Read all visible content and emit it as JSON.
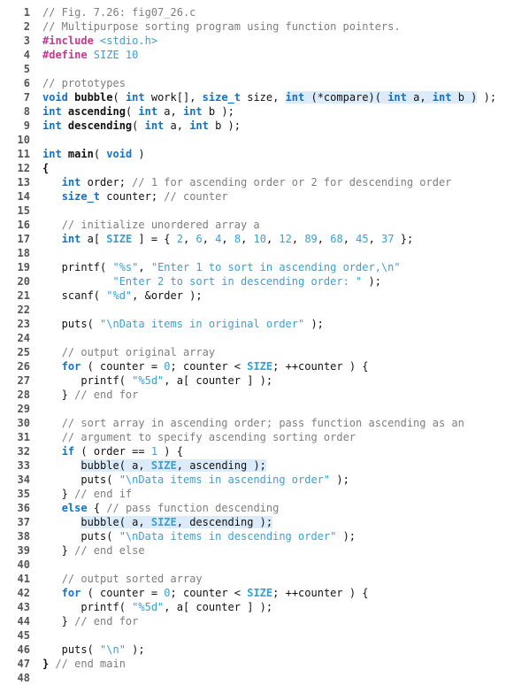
{
  "language": "c",
  "figure": "Fig. 7.26: fig07_26.c",
  "title_comment": "Multipurpose sorting program using function pointers.",
  "macros": {
    "SIZE": "10"
  },
  "array_init": [
    "2",
    "6",
    "4",
    "8",
    "10",
    "12",
    "89",
    "68",
    "45",
    "37"
  ],
  "lines": [
    {
      "n": "1",
      "segs": [
        {
          "t": "// Fig. 7.26: fig07_26.c",
          "cls": "c"
        }
      ]
    },
    {
      "n": "2",
      "segs": [
        {
          "t": "// Multipurpose sorting program using function pointers.",
          "cls": "c"
        }
      ]
    },
    {
      "n": "3",
      "segs": [
        {
          "t": "#include ",
          "cls": "pp"
        },
        {
          "t": "<stdio.h>",
          "cls": "s"
        }
      ]
    },
    {
      "n": "4",
      "segs": [
        {
          "t": "#define ",
          "cls": "pp"
        },
        {
          "t": "SIZE 10",
          "cls": "s"
        }
      ]
    },
    {
      "n": "5",
      "segs": [
        {
          "t": "",
          "cls": "id"
        }
      ]
    },
    {
      "n": "6",
      "segs": [
        {
          "t": "// prototypes",
          "cls": "c"
        }
      ]
    },
    {
      "n": "7",
      "segs": [
        {
          "t": "void ",
          "cls": "kw"
        },
        {
          "t": "bubble",
          "cls": "fn"
        },
        {
          "t": "( ",
          "cls": "op"
        },
        {
          "t": "int ",
          "cls": "ty"
        },
        {
          "t": "work[], ",
          "cls": "id"
        },
        {
          "t": "size_t ",
          "cls": "ty"
        },
        {
          "t": "size, ",
          "cls": "id"
        },
        {
          "t": "int ",
          "cls": "ty",
          "hi": true
        },
        {
          "t": "(*compare)( ",
          "cls": "id",
          "hi": true
        },
        {
          "t": "int ",
          "cls": "ty",
          "hi": true
        },
        {
          "t": "a, ",
          "cls": "id",
          "hi": true
        },
        {
          "t": "int ",
          "cls": "ty",
          "hi": true
        },
        {
          "t": "b )",
          "cls": "id",
          "hi": true
        },
        {
          "t": " );",
          "cls": "op"
        }
      ]
    },
    {
      "n": "8",
      "segs": [
        {
          "t": "int ",
          "cls": "ty"
        },
        {
          "t": "ascending",
          "cls": "fn"
        },
        {
          "t": "( ",
          "cls": "op"
        },
        {
          "t": "int ",
          "cls": "ty"
        },
        {
          "t": "a, ",
          "cls": "id"
        },
        {
          "t": "int ",
          "cls": "ty"
        },
        {
          "t": "b );",
          "cls": "id"
        }
      ]
    },
    {
      "n": "9",
      "segs": [
        {
          "t": "int ",
          "cls": "ty"
        },
        {
          "t": "descending",
          "cls": "fn"
        },
        {
          "t": "( ",
          "cls": "op"
        },
        {
          "t": "int ",
          "cls": "ty"
        },
        {
          "t": "a, ",
          "cls": "id"
        },
        {
          "t": "int ",
          "cls": "ty"
        },
        {
          "t": "b );",
          "cls": "id"
        }
      ]
    },
    {
      "n": "10",
      "segs": [
        {
          "t": "",
          "cls": "id"
        }
      ]
    },
    {
      "n": "11",
      "segs": [
        {
          "t": "int ",
          "cls": "ty"
        },
        {
          "t": "main",
          "cls": "fn"
        },
        {
          "t": "( ",
          "cls": "op"
        },
        {
          "t": "void",
          "cls": "kw"
        },
        {
          "t": " )",
          "cls": "op"
        }
      ]
    },
    {
      "n": "12",
      "segs": [
        {
          "t": "{",
          "cls": "br"
        }
      ]
    },
    {
      "n": "13",
      "segs": [
        {
          "t": "   ",
          "cls": "id"
        },
        {
          "t": "int ",
          "cls": "ty"
        },
        {
          "t": "order; ",
          "cls": "id"
        },
        {
          "t": "// 1 for ascending order or 2 for descending order",
          "cls": "c"
        }
      ]
    },
    {
      "n": "14",
      "segs": [
        {
          "t": "   ",
          "cls": "id"
        },
        {
          "t": "size_t ",
          "cls": "ty"
        },
        {
          "t": "counter; ",
          "cls": "id"
        },
        {
          "t": "// counter",
          "cls": "c"
        }
      ]
    },
    {
      "n": "15",
      "segs": [
        {
          "t": "",
          "cls": "id"
        }
      ]
    },
    {
      "n": "16",
      "segs": [
        {
          "t": "   ",
          "cls": "id"
        },
        {
          "t": "// initialize unordered array a",
          "cls": "c"
        }
      ]
    },
    {
      "n": "17",
      "segs": [
        {
          "t": "   ",
          "cls": "id"
        },
        {
          "t": "int ",
          "cls": "ty"
        },
        {
          "t": "a[ ",
          "cls": "id"
        },
        {
          "t": "SIZE",
          "cls": "m"
        },
        {
          "t": " ] = { ",
          "cls": "id"
        },
        {
          "t": "2",
          "cls": "n"
        },
        {
          "t": ", ",
          "cls": "id"
        },
        {
          "t": "6",
          "cls": "n"
        },
        {
          "t": ", ",
          "cls": "id"
        },
        {
          "t": "4",
          "cls": "n"
        },
        {
          "t": ", ",
          "cls": "id"
        },
        {
          "t": "8",
          "cls": "n"
        },
        {
          "t": ", ",
          "cls": "id"
        },
        {
          "t": "10",
          "cls": "n"
        },
        {
          "t": ", ",
          "cls": "id"
        },
        {
          "t": "12",
          "cls": "n"
        },
        {
          "t": ", ",
          "cls": "id"
        },
        {
          "t": "89",
          "cls": "n"
        },
        {
          "t": ", ",
          "cls": "id"
        },
        {
          "t": "68",
          "cls": "n"
        },
        {
          "t": ", ",
          "cls": "id"
        },
        {
          "t": "45",
          "cls": "n"
        },
        {
          "t": ", ",
          "cls": "id"
        },
        {
          "t": "37",
          "cls": "n"
        },
        {
          "t": " };",
          "cls": "id"
        }
      ]
    },
    {
      "n": "18",
      "segs": [
        {
          "t": "",
          "cls": "id"
        }
      ]
    },
    {
      "n": "19",
      "segs": [
        {
          "t": "   printf( ",
          "cls": "id"
        },
        {
          "t": "\"%s\"",
          "cls": "s"
        },
        {
          "t": ", ",
          "cls": "id"
        },
        {
          "t": "\"Enter 1 to sort in ascending order,\\n\"",
          "cls": "s"
        }
      ]
    },
    {
      "n": "20",
      "segs": [
        {
          "t": "           ",
          "cls": "id"
        },
        {
          "t": "\"Enter 2 to sort in descending order: \"",
          "cls": "s"
        },
        {
          "t": " );",
          "cls": "id"
        }
      ]
    },
    {
      "n": "21",
      "segs": [
        {
          "t": "   scanf( ",
          "cls": "id"
        },
        {
          "t": "\"%d\"",
          "cls": "s"
        },
        {
          "t": ", &order );",
          "cls": "id"
        }
      ]
    },
    {
      "n": "22",
      "segs": [
        {
          "t": "",
          "cls": "id"
        }
      ]
    },
    {
      "n": "23",
      "segs": [
        {
          "t": "   puts( ",
          "cls": "id"
        },
        {
          "t": "\"\\nData items in original order\"",
          "cls": "s"
        },
        {
          "t": " );",
          "cls": "id"
        }
      ]
    },
    {
      "n": "24",
      "segs": [
        {
          "t": "",
          "cls": "id"
        }
      ]
    },
    {
      "n": "25",
      "segs": [
        {
          "t": "   ",
          "cls": "id"
        },
        {
          "t": "// output original array",
          "cls": "c"
        }
      ]
    },
    {
      "n": "26",
      "segs": [
        {
          "t": "   ",
          "cls": "id"
        },
        {
          "t": "for",
          "cls": "kw"
        },
        {
          "t": " ( counter = ",
          "cls": "id"
        },
        {
          "t": "0",
          "cls": "n"
        },
        {
          "t": "; counter < ",
          "cls": "id"
        },
        {
          "t": "SIZE",
          "cls": "m"
        },
        {
          "t": "; ++counter ) {",
          "cls": "id"
        }
      ]
    },
    {
      "n": "27",
      "segs": [
        {
          "t": "      printf( ",
          "cls": "id"
        },
        {
          "t": "\"%5d\"",
          "cls": "s"
        },
        {
          "t": ", a[ counter ] );",
          "cls": "id"
        }
      ]
    },
    {
      "n": "28",
      "segs": [
        {
          "t": "   } ",
          "cls": "id"
        },
        {
          "t": "// end for",
          "cls": "c"
        }
      ]
    },
    {
      "n": "29",
      "segs": [
        {
          "t": "",
          "cls": "id"
        }
      ]
    },
    {
      "n": "30",
      "segs": [
        {
          "t": "   ",
          "cls": "id"
        },
        {
          "t": "// sort array in ascending order; pass function ascending as an",
          "cls": "c"
        }
      ]
    },
    {
      "n": "31",
      "segs": [
        {
          "t": "   ",
          "cls": "id"
        },
        {
          "t": "// argument to specify ascending sorting order",
          "cls": "c"
        }
      ]
    },
    {
      "n": "32",
      "segs": [
        {
          "t": "   ",
          "cls": "id"
        },
        {
          "t": "if",
          "cls": "kw"
        },
        {
          "t": " ( order == ",
          "cls": "id"
        },
        {
          "t": "1",
          "cls": "n"
        },
        {
          "t": " ) {",
          "cls": "id"
        }
      ]
    },
    {
      "n": "33",
      "segs": [
        {
          "t": "      ",
          "cls": "id"
        },
        {
          "t": "bubble( a, ",
          "cls": "id",
          "hi": true
        },
        {
          "t": "SIZE",
          "cls": "m",
          "hi": true
        },
        {
          "t": ", ascending );",
          "cls": "id",
          "hi": true
        }
      ]
    },
    {
      "n": "34",
      "segs": [
        {
          "t": "      puts( ",
          "cls": "id"
        },
        {
          "t": "\"\\nData items in ascending order\"",
          "cls": "s"
        },
        {
          "t": " );",
          "cls": "id"
        }
      ]
    },
    {
      "n": "35",
      "segs": [
        {
          "t": "   } ",
          "cls": "id"
        },
        {
          "t": "// end if",
          "cls": "c"
        }
      ]
    },
    {
      "n": "36",
      "segs": [
        {
          "t": "   ",
          "cls": "id"
        },
        {
          "t": "else",
          "cls": "kw"
        },
        {
          "t": " { ",
          "cls": "id"
        },
        {
          "t": "// pass function descending",
          "cls": "c"
        }
      ]
    },
    {
      "n": "37",
      "segs": [
        {
          "t": "      ",
          "cls": "id"
        },
        {
          "t": "bubble( a, ",
          "cls": "id",
          "hi": true
        },
        {
          "t": "SIZE",
          "cls": "m",
          "hi": true
        },
        {
          "t": ", descending );",
          "cls": "id",
          "hi": true
        }
      ]
    },
    {
      "n": "38",
      "segs": [
        {
          "t": "      puts( ",
          "cls": "id"
        },
        {
          "t": "\"\\nData items in descending order\"",
          "cls": "s"
        },
        {
          "t": " );",
          "cls": "id"
        }
      ]
    },
    {
      "n": "39",
      "segs": [
        {
          "t": "   } ",
          "cls": "id"
        },
        {
          "t": "// end else",
          "cls": "c"
        }
      ]
    },
    {
      "n": "40",
      "segs": [
        {
          "t": "",
          "cls": "id"
        }
      ]
    },
    {
      "n": "41",
      "segs": [
        {
          "t": "   ",
          "cls": "id"
        },
        {
          "t": "// output sorted array",
          "cls": "c"
        }
      ]
    },
    {
      "n": "42",
      "segs": [
        {
          "t": "   ",
          "cls": "id"
        },
        {
          "t": "for",
          "cls": "kw"
        },
        {
          "t": " ( counter = ",
          "cls": "id"
        },
        {
          "t": "0",
          "cls": "n"
        },
        {
          "t": "; counter < ",
          "cls": "id"
        },
        {
          "t": "SIZE",
          "cls": "m"
        },
        {
          "t": "; ++counter ) {",
          "cls": "id"
        }
      ]
    },
    {
      "n": "43",
      "segs": [
        {
          "t": "      printf( ",
          "cls": "id"
        },
        {
          "t": "\"%5d\"",
          "cls": "s"
        },
        {
          "t": ", a[ counter ] );",
          "cls": "id"
        }
      ]
    },
    {
      "n": "44",
      "segs": [
        {
          "t": "   } ",
          "cls": "id"
        },
        {
          "t": "// end for",
          "cls": "c"
        }
      ]
    },
    {
      "n": "45",
      "segs": [
        {
          "t": "",
          "cls": "id"
        }
      ]
    },
    {
      "n": "46",
      "segs": [
        {
          "t": "   puts( ",
          "cls": "id"
        },
        {
          "t": "\"\\n\"",
          "cls": "s"
        },
        {
          "t": " );",
          "cls": "id"
        }
      ]
    },
    {
      "n": "47",
      "segs": [
        {
          "t": "} ",
          "cls": "br"
        },
        {
          "t": "// end main",
          "cls": "c"
        }
      ]
    },
    {
      "n": "48",
      "segs": [
        {
          "t": "",
          "cls": "id"
        }
      ]
    }
  ]
}
